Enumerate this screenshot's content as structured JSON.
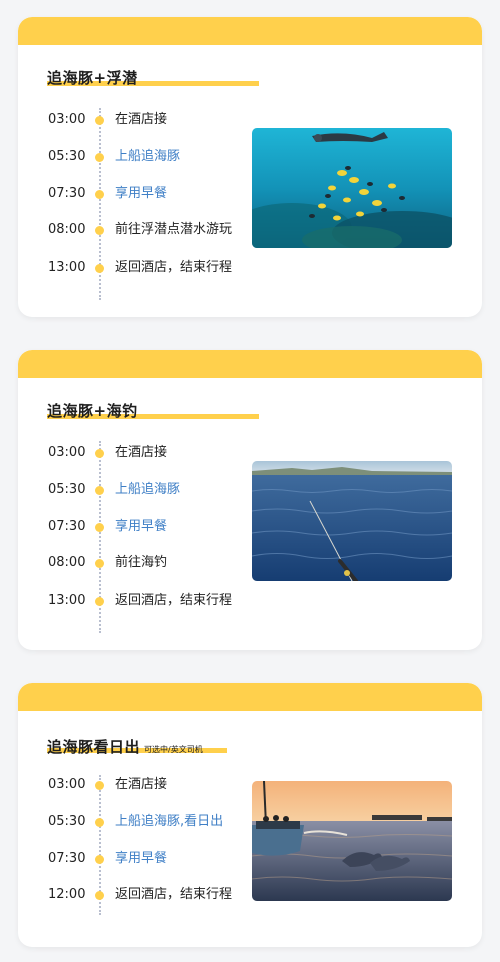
{
  "colors": {
    "accent": "#ffd04c",
    "highlight_text": "#3f7fc6",
    "background": "#f4f5f7",
    "card": "#ffffff"
  },
  "cards": [
    {
      "title": "追海豚+浮潜",
      "note": "",
      "photo": "snorkeling-photo",
      "items": [
        {
          "time": "03:00",
          "text": "在酒店接",
          "highlight": false
        },
        {
          "time": "05:30",
          "text": "上船追海豚",
          "highlight": true
        },
        {
          "time": "07:30",
          "text": "享用早餐",
          "highlight": true
        },
        {
          "time": "08:00",
          "text": "前往浮潜点潜水游玩",
          "highlight": false
        },
        {
          "time": "13:00",
          "text": "返回酒店，结束行程",
          "highlight": false
        }
      ]
    },
    {
      "title": "追海豚+海钓",
      "note": "",
      "photo": "sea-fishing-photo",
      "items": [
        {
          "time": "03:00",
          "text": "在酒店接",
          "highlight": false
        },
        {
          "time": "05:30",
          "text": "上船追海豚",
          "highlight": true
        },
        {
          "time": "07:30",
          "text": "享用早餐",
          "highlight": true
        },
        {
          "time": "08:00",
          "text": "前往海钓",
          "highlight": false
        },
        {
          "time": "13:00",
          "text": "返回酒店，结束行程",
          "highlight": false
        }
      ]
    },
    {
      "title": "追海豚看日出",
      "note": "可选中/英文司机",
      "photo": "sunrise-dolphin-photo",
      "items": [
        {
          "time": "03:00",
          "text": "在酒店接",
          "highlight": false
        },
        {
          "time": "05:30",
          "text": "上船追海豚,看日出",
          "highlight": true
        },
        {
          "time": "07:30",
          "text": "享用早餐",
          "highlight": true
        },
        {
          "time": "12:00",
          "text": "返回酒店，结束行程",
          "highlight": false
        }
      ]
    }
  ]
}
